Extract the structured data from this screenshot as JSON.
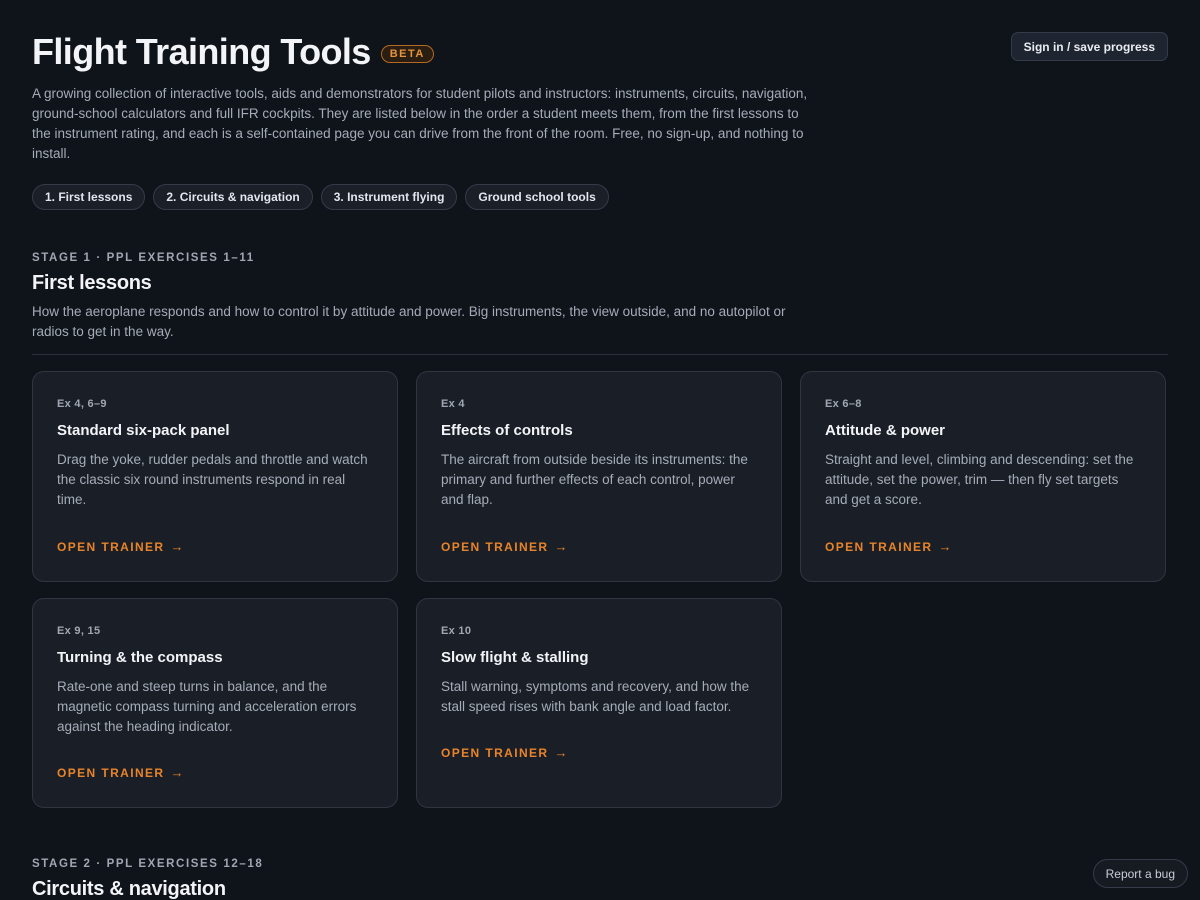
{
  "header": {
    "title": "Flight Training Tools",
    "badge": "BETA",
    "signin_label": "Sign in / save progress",
    "intro": "A growing collection of interactive tools, aids and demonstrators for student pilots and instructors: instruments, circuits, navigation, ground-school calculators and full IFR cockpits. They are listed below in the order a student meets them, from the first lessons to the instrument rating, and each is a self-contained page you can drive from the front of the room. Free, no sign-up, and nothing to install."
  },
  "nav_chips": [
    {
      "label": "1. First lessons"
    },
    {
      "label": "2. Circuits & navigation"
    },
    {
      "label": "3. Instrument flying"
    },
    {
      "label": "Ground school tools"
    }
  ],
  "stage1": {
    "label": "STAGE 1 · PPL EXERCISES 1–11",
    "title": "First lessons",
    "description": "How the aeroplane responds and how to control it by attitude and power. Big instruments, the view outside, and no autopilot or radios to get in the way.",
    "cards": [
      {
        "ex": "Ex 4, 6–9",
        "title": "Standard six-pack panel",
        "desc": "Drag the yoke, rudder pedals and throttle and watch the classic six round instruments respond in real time.",
        "link": "OPEN TRAINER"
      },
      {
        "ex": "Ex 4",
        "title": "Effects of controls",
        "desc": "The aircraft from outside beside its instruments: the primary and further effects of each control, power and flap.",
        "link": "OPEN TRAINER"
      },
      {
        "ex": "Ex 6–8",
        "title": "Attitude & power",
        "desc": "Straight and level, climbing and descending: set the attitude, set the power, trim — then fly set targets and get a score.",
        "link": "OPEN TRAINER"
      },
      {
        "ex": "Ex 9, 15",
        "title": "Turning & the compass",
        "desc": "Rate-one and steep turns in balance, and the magnetic compass turning and acceleration errors against the heading indicator.",
        "link": "OPEN TRAINER"
      },
      {
        "ex": "Ex 10",
        "title": "Slow flight & stalling",
        "desc": "Stall warning, symptoms and recovery, and how the stall speed rises with bank angle and load factor.",
        "link": "OPEN TRAINER"
      }
    ]
  },
  "stage2": {
    "label": "STAGE 2 · PPL EXERCISES 12–18",
    "title": "Circuits & navigation"
  },
  "footer": {
    "report_label": "Report a bug"
  }
}
